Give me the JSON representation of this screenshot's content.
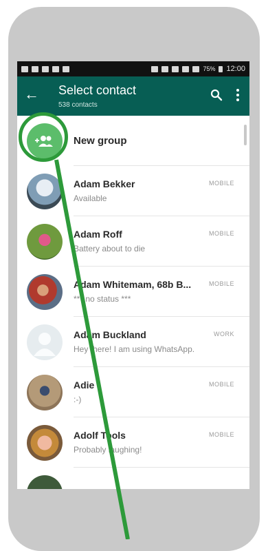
{
  "colors": {
    "appbar": "#075e54",
    "accent_green": "#2d9a3a",
    "group_avatar": "#5cbd6b"
  },
  "status_bar": {
    "battery": "75%",
    "time": "12:00"
  },
  "header": {
    "title": "Select contact",
    "subtitle": "538 contacts"
  },
  "new_group": {
    "label": "New group"
  },
  "contacts": [
    {
      "name": "Adam Bekker",
      "status": "Available",
      "tag": "MOBILE"
    },
    {
      "name": "Adam Roff",
      "status": "Battery about to die",
      "tag": "MOBILE"
    },
    {
      "name": "Adam Whitemam, 68b B...",
      "status": "*** no status ***",
      "tag": "MOBILE"
    },
    {
      "name": "Adam Buckland",
      "status": "Hey there! I am using WhatsApp.",
      "tag": "WORK"
    },
    {
      "name": "Adie",
      "status": ":-)",
      "tag": "MOBILE"
    },
    {
      "name": "Adolf Tools",
      "status": "Probably laughing!",
      "tag": "MOBILE"
    }
  ]
}
